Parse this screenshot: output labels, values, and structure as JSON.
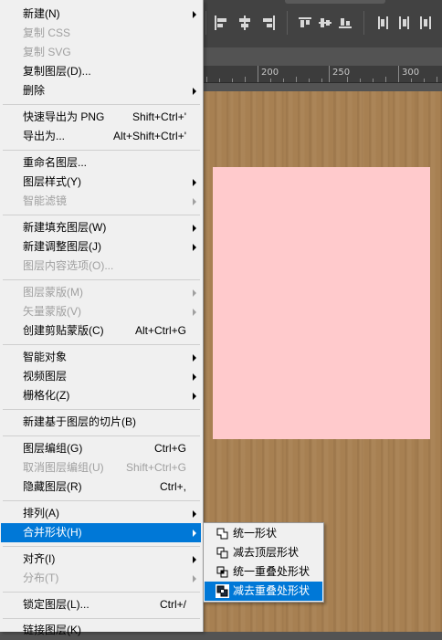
{
  "ruler": {
    "labels": [
      "200",
      "250",
      "300"
    ]
  },
  "toolbar": {
    "icons": [
      "align-left-edges-icon",
      "align-horizontal-centers-icon",
      "align-right-edges-icon",
      "distribute-top-icon",
      "distribute-vertical-centers-icon",
      "distribute-bottom-icon",
      "distribute-left-icon",
      "distribute-horizontal-centers-icon",
      "distribute-right-icon"
    ]
  },
  "canvas": {
    "background": "#a78052",
    "shape_color": "#ffcacc"
  },
  "menu": {
    "items": [
      {
        "label": "新建(N)",
        "shortcut": "",
        "submenu": true,
        "disabled": false
      },
      {
        "label": "复制 CSS",
        "shortcut": "",
        "submenu": false,
        "disabled": true
      },
      {
        "label": "复制 SVG",
        "shortcut": "",
        "submenu": false,
        "disabled": true
      },
      {
        "label": "复制图层(D)...",
        "shortcut": "",
        "submenu": false,
        "disabled": false
      },
      {
        "label": "删除",
        "shortcut": "",
        "submenu": true,
        "disabled": false
      },
      {
        "label": "快速导出为 PNG",
        "shortcut": "Shift+Ctrl+'",
        "submenu": false,
        "disabled": false
      },
      {
        "label": "导出为...",
        "shortcut": "Alt+Shift+Ctrl+'",
        "submenu": false,
        "disabled": false
      },
      {
        "label": "重命名图层...",
        "shortcut": "",
        "submenu": false,
        "disabled": false
      },
      {
        "label": "图层样式(Y)",
        "shortcut": "",
        "submenu": true,
        "disabled": false
      },
      {
        "label": "智能滤镜",
        "shortcut": "",
        "submenu": true,
        "disabled": true
      },
      {
        "label": "新建填充图层(W)",
        "shortcut": "",
        "submenu": true,
        "disabled": false
      },
      {
        "label": "新建调整图层(J)",
        "shortcut": "",
        "submenu": true,
        "disabled": false
      },
      {
        "label": "图层内容选项(O)...",
        "shortcut": "",
        "submenu": false,
        "disabled": true
      },
      {
        "label": "图层蒙版(M)",
        "shortcut": "",
        "submenu": true,
        "disabled": true
      },
      {
        "label": "矢量蒙版(V)",
        "shortcut": "",
        "submenu": true,
        "disabled": true
      },
      {
        "label": "创建剪贴蒙版(C)",
        "shortcut": "Alt+Ctrl+G",
        "submenu": false,
        "disabled": false
      },
      {
        "label": "智能对象",
        "shortcut": "",
        "submenu": true,
        "disabled": false
      },
      {
        "label": "视频图层",
        "shortcut": "",
        "submenu": true,
        "disabled": false
      },
      {
        "label": "栅格化(Z)",
        "shortcut": "",
        "submenu": true,
        "disabled": false
      },
      {
        "label": "新建基于图层的切片(B)",
        "shortcut": "",
        "submenu": false,
        "disabled": false
      },
      {
        "label": "图层编组(G)",
        "shortcut": "Ctrl+G",
        "submenu": false,
        "disabled": false
      },
      {
        "label": "取消图层编组(U)",
        "shortcut": "Shift+Ctrl+G",
        "submenu": false,
        "disabled": true
      },
      {
        "label": "隐藏图层(R)",
        "shortcut": "Ctrl+,",
        "submenu": false,
        "disabled": false
      },
      {
        "label": "排列(A)",
        "shortcut": "",
        "submenu": true,
        "disabled": false
      },
      {
        "label": "合并形状(H)",
        "shortcut": "",
        "submenu": true,
        "disabled": false,
        "highlighted": true
      },
      {
        "label": "对齐(I)",
        "shortcut": "",
        "submenu": true,
        "disabled": false
      },
      {
        "label": "分布(T)",
        "shortcut": "",
        "submenu": true,
        "disabled": true
      },
      {
        "label": "锁定图层(L)...",
        "shortcut": "Ctrl+/",
        "submenu": false,
        "disabled": false
      },
      {
        "label": "链接图层(K)",
        "shortcut": "",
        "submenu": false,
        "disabled": false
      }
    ]
  },
  "submenu": {
    "items": [
      {
        "label": "统一形状",
        "icon": "unite-shapes-icon",
        "highlighted": false
      },
      {
        "label": "减去顶层形状",
        "icon": "subtract-front-shape-icon",
        "highlighted": false
      },
      {
        "label": "统一重叠处形状",
        "icon": "intersect-shape-areas-icon",
        "highlighted": false
      },
      {
        "label": "减去重叠处形状",
        "icon": "exclude-overlapping-shapes-icon",
        "highlighted": true
      }
    ]
  }
}
